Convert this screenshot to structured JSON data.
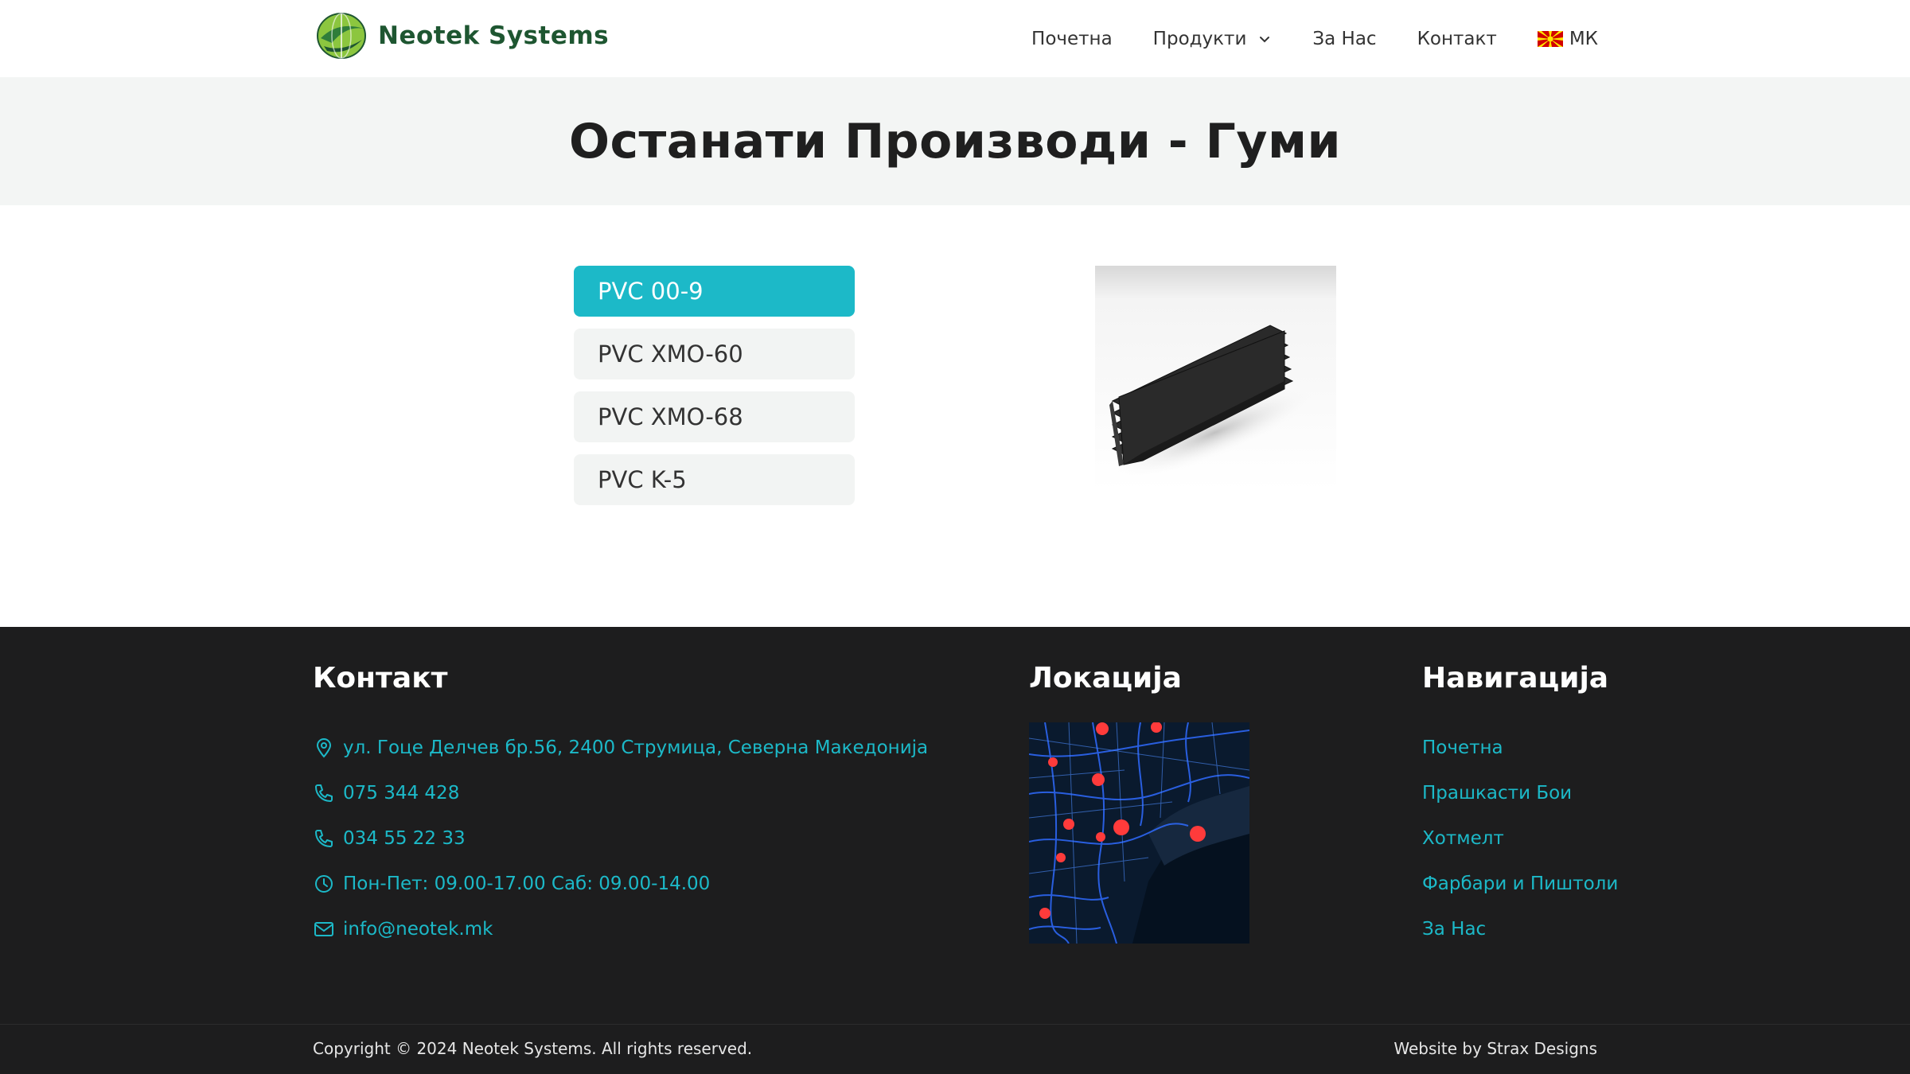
{
  "header": {
    "logo_text": "Neotek Systems",
    "nav": [
      {
        "label": "Почетна"
      },
      {
        "label": "Продукти"
      },
      {
        "label": "За Нас"
      },
      {
        "label": "Контакт"
      },
      {
        "label": "МК"
      }
    ],
    "brand_color": "#1e5631"
  },
  "page": {
    "title": "Останати Производи - Гуми"
  },
  "products": {
    "tabs": [
      {
        "label": "PVC 00-9",
        "active": true
      },
      {
        "label": "PVC XMO-60",
        "active": false
      },
      {
        "label": "PVC XMO-68",
        "active": false
      },
      {
        "label": "PVC K-5",
        "active": false
      }
    ],
    "accent_color": "#1cb9c8"
  },
  "footer": {
    "contact_title": "Контакт",
    "contact": [
      {
        "icon": "location-pin-icon",
        "text": "ул. Гоце Делчев бр.56, 2400 Струмица, Северна Македонија"
      },
      {
        "icon": "phone-icon",
        "text": "075 344 428"
      },
      {
        "icon": "phone-icon",
        "text": "034 55 22 33"
      },
      {
        "icon": "clock-icon",
        "text": "Пон-Пет: 09.00-17.00 Саб: 09.00-14.00"
      },
      {
        "icon": "mail-icon",
        "text": "info@neotek.mk"
      }
    ],
    "location_title": "Локација",
    "navigation_title": "Навигација",
    "nav_links": [
      {
        "label": "Почетна"
      },
      {
        "label": "Прашкасти Бои"
      },
      {
        "label": "Хотмелт"
      },
      {
        "label": "Фарбари и Пиштоли"
      },
      {
        "label": "За Нас"
      }
    ],
    "copyright": "Copyright © 2024 Neotek Systems. All rights reserved.",
    "credit": "Website by Strax Designs",
    "background": "#1d1d1e"
  }
}
